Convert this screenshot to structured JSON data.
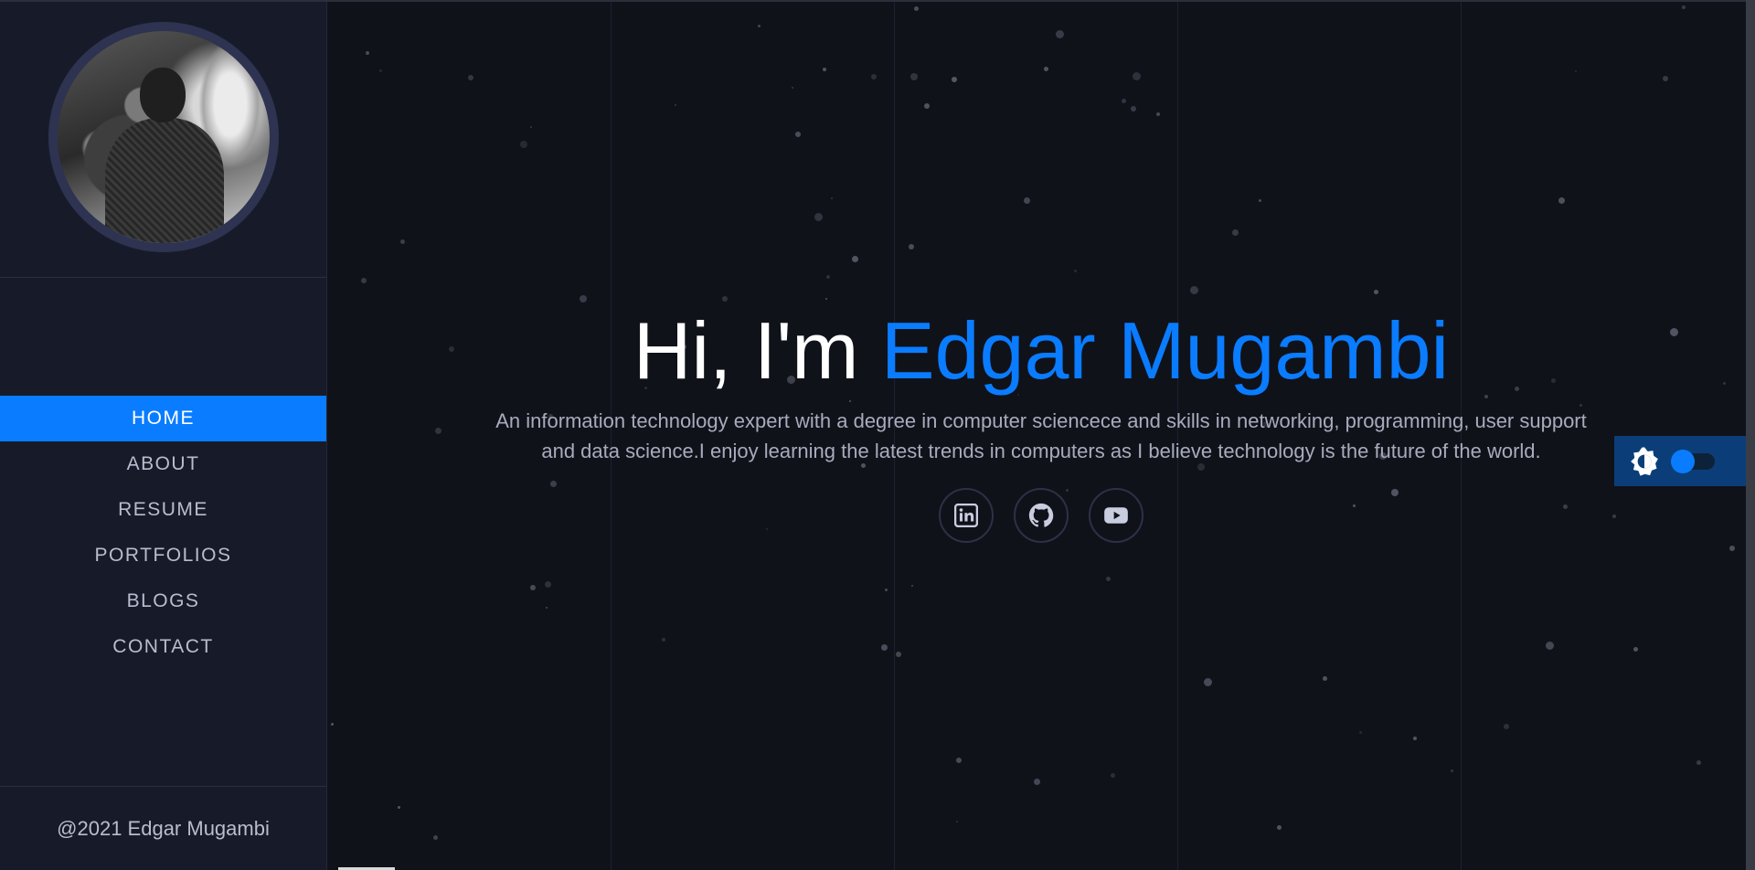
{
  "sidebar": {
    "avatar_alt": "Edgar Mugambi",
    "nav": [
      {
        "label": "HOME",
        "active": true
      },
      {
        "label": "ABOUT",
        "active": false
      },
      {
        "label": "RESUME",
        "active": false
      },
      {
        "label": "PORTFOLIOS",
        "active": false
      },
      {
        "label": "BLOGS",
        "active": false
      },
      {
        "label": "CONTACT",
        "active": false
      }
    ],
    "footer": "@2021 Edgar Mugambi"
  },
  "hero": {
    "greeting": "Hi, I'm ",
    "name": "Edgar Mugambi",
    "description": "An information technology expert with a degree in computer sciencece and skills in networking, programming, user support and data science.I enjoy learning the latest trends in computers as I believe technology is the future of the world."
  },
  "socials": [
    {
      "icon": "linkedin-icon"
    },
    {
      "icon": "github-icon"
    },
    {
      "icon": "youtube-icon"
    }
  ],
  "theme_toggle": {
    "icon": "brightness-icon",
    "dark_mode": true
  },
  "colors": {
    "accent": "#0a7cff",
    "background": "#10121a",
    "sidebar": "#171b29"
  }
}
